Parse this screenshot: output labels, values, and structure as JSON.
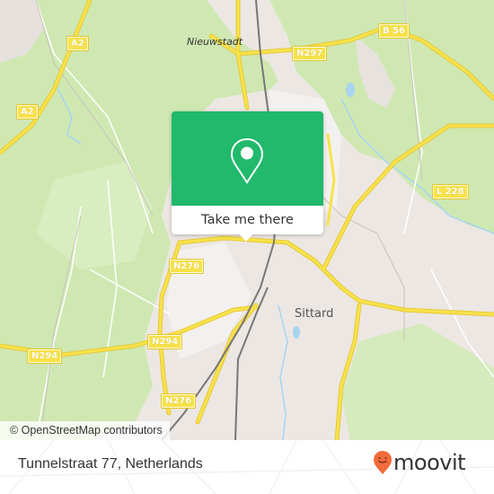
{
  "map": {
    "attribution": "© OpenStreetMap contributors",
    "places": {
      "nieuwstadt": "Nieuwstadt",
      "sittard": "Sittard"
    },
    "road_shields": [
      {
        "id": "a2-top",
        "label": "A2"
      },
      {
        "id": "a2-left",
        "label": "A2"
      },
      {
        "id": "n297",
        "label": "N297"
      },
      {
        "id": "b56",
        "label": "B 56"
      },
      {
        "id": "l228",
        "label": "L 228"
      },
      {
        "id": "n276-upper",
        "label": "N276"
      },
      {
        "id": "n294-middle",
        "label": "N294"
      },
      {
        "id": "n294-left",
        "label": "N294"
      },
      {
        "id": "n276-lower",
        "label": "N276"
      }
    ],
    "colors": {
      "forest": "#cfe8b2",
      "urban": "#ece7e3",
      "road": "#f7e24a",
      "water": "#a8d4f0",
      "rail": "#777777"
    }
  },
  "popup": {
    "button_label": "Take me there",
    "accent": "#21b96b",
    "icon": "map-pin-icon"
  },
  "footer": {
    "address": "Tunnelstraat 77, Netherlands",
    "brand": "moovit",
    "brand_color": "#f26b3a"
  }
}
